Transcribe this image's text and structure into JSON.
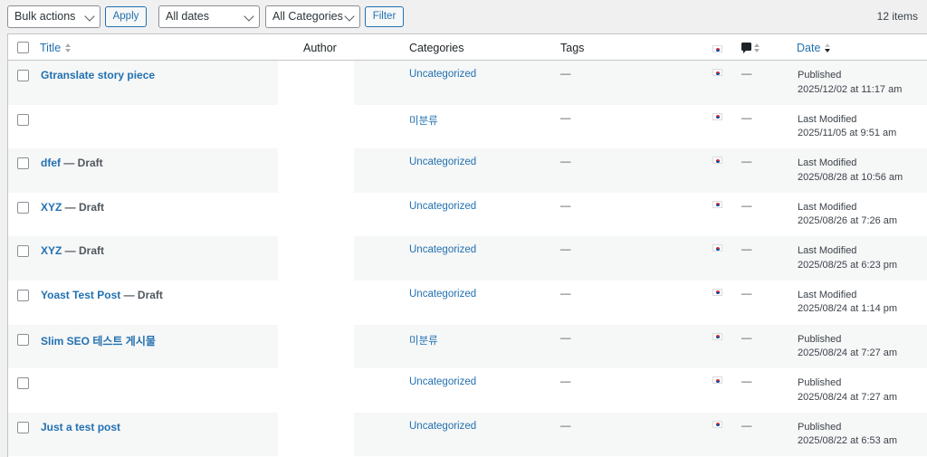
{
  "toolbar": {
    "bulk_actions": "Bulk actions",
    "apply": "Apply",
    "dates": "All dates",
    "categories": "All Categories",
    "filter": "Filter",
    "count": "12 items"
  },
  "columns": {
    "title": "Title",
    "author": "Author",
    "categories": "Categories",
    "tags": "Tags",
    "date": "Date"
  },
  "posts": [
    {
      "title": "Gtranslate story piece",
      "state": "",
      "category": "Uncategorized",
      "tags": "—",
      "comments": "—",
      "date_status": "Published",
      "date_value": "2025/12/02 at 11:17 am"
    },
    {
      "title": "",
      "state": "",
      "category": "미분류",
      "tags": "—",
      "comments": "—",
      "date_status": "Last Modified",
      "date_value": "2025/11/05 at 9:51 am"
    },
    {
      "title": "dfef",
      "state": " — Draft",
      "category": "Uncategorized",
      "tags": "—",
      "comments": "—",
      "date_status": "Last Modified",
      "date_value": "2025/08/28 at 10:56 am"
    },
    {
      "title": "XYZ",
      "state": " — Draft",
      "category": "Uncategorized",
      "tags": "—",
      "comments": "—",
      "date_status": "Last Modified",
      "date_value": "2025/08/26 at 7:26 am"
    },
    {
      "title": "XYZ",
      "state": " — Draft",
      "category": "Uncategorized",
      "tags": "—",
      "comments": "—",
      "date_status": "Last Modified",
      "date_value": "2025/08/25 at 6:23 pm"
    },
    {
      "title": "Yoast Test Post",
      "state": " — Draft",
      "category": "Uncategorized",
      "tags": "—",
      "comments": "—",
      "date_status": "Last Modified",
      "date_value": "2025/08/24 at 1:14 pm"
    },
    {
      "title": "Slim SEO 테스트 게시물",
      "state": "",
      "category": "미분류",
      "tags": "—",
      "comments": "—",
      "date_status": "Published",
      "date_value": "2025/08/24 at 7:27 am"
    },
    {
      "title": "",
      "state": "",
      "category": "Uncategorized",
      "tags": "—",
      "comments": "—",
      "date_status": "Published",
      "date_value": "2025/08/24 at 7:27 am"
    },
    {
      "title": "Just a test post",
      "state": "",
      "category": "Uncategorized",
      "tags": "—",
      "comments": "—",
      "date_status": "Published",
      "date_value": "2025/08/22 at 6:53 am"
    }
  ]
}
